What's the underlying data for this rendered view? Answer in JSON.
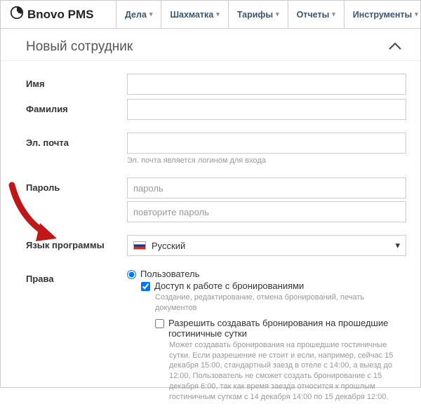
{
  "brand": "Bnovo PMS",
  "nav": {
    "items": [
      {
        "label": "Дела"
      },
      {
        "label": "Шахматка"
      },
      {
        "label": "Тарифы"
      },
      {
        "label": "Отчеты"
      },
      {
        "label": "Инструменты"
      }
    ]
  },
  "panel": {
    "title": "Новый сотрудник"
  },
  "form": {
    "name_label": "Имя",
    "surname_label": "Фамилия",
    "email_label": "Эл. почта",
    "email_hint": "Эл. почта является логином для входа",
    "password_label": "Пароль",
    "password_placeholder": "пароль",
    "password_repeat_placeholder": "повторите пароль",
    "lang_label": "Язык программы",
    "lang_selected": "Русский",
    "rights_label": "Права",
    "rights": {
      "user_role": "Пользователь",
      "booking_access": "Доступ к работе с бронированиями",
      "booking_access_desc": "Создание, редактирование, отмена бронирований, печать документов",
      "allow_past": "Разрешить создавать бронирования на прошедшие гостиничные сутки",
      "allow_past_desc": "Может создавать бронирования на прошедшие гостиничные сутки. Если разрешение не стоит и если, например, сейчас 15 декабря 15:00, стандартный заезд в отеле с 14:00, а выезд до 12:00, Пользователь не сможет создать бронирование с 15 декабря 6:00, так как время заезда относится к прошлым гостиничным суткам с 14 декабря 14:00 по 15 декабря 12:00."
    }
  }
}
